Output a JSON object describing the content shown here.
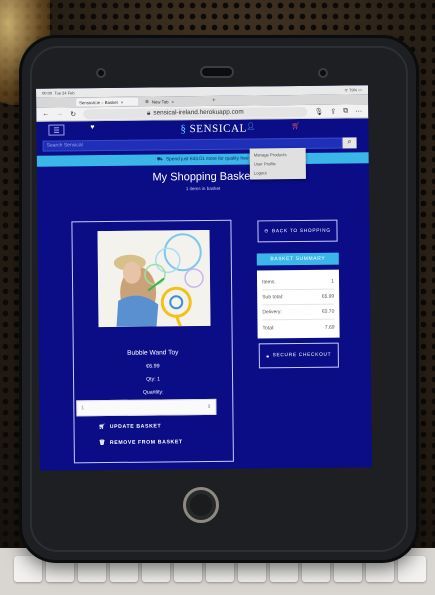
{
  "browser": {
    "status_time": "00:00",
    "status_date": "Tue 24 Feb",
    "status_right": "ᯤ 79% ▭",
    "tabs": [
      {
        "label": "Sensical.ie – Basket",
        "active": true
      },
      {
        "label": "New Tab",
        "active": false
      }
    ],
    "new_tab_label": "+",
    "url": "sensical-ireland.herokuapp.com"
  },
  "site": {
    "logo_text": "SENSICAL",
    "search_placeholder": "Search Sensical",
    "banner_text": "Spend just €43.01 more for quality free",
    "dropdown": [
      "Manage Products",
      "User Profile",
      "Logout"
    ]
  },
  "basket": {
    "title": "My Shopping Basket",
    "subtitle": "1 items in basket"
  },
  "product": {
    "name": "Bubble Wand Toy",
    "price": "€6.99",
    "qty": "Qty: 1",
    "quantity_label": "Quantity:",
    "quantity_value": "1",
    "update_label": "UPDATE BASKET",
    "remove_label": "REMOVE FROM BASKET"
  },
  "sidebar": {
    "back_label": "BACK TO SHOPPING",
    "summary_title": "BASKET SUMMARY",
    "rows": [
      {
        "label": "Items:",
        "value": "1"
      },
      {
        "label": "Sub total:",
        "value": "€6.99"
      },
      {
        "label": "Delivery:",
        "value": "€0.70"
      },
      {
        "label": "Total:",
        "value": "7.69"
      }
    ],
    "checkout_label": "SECURE CHECKOUT"
  },
  "icons": {
    "back": "arrow-left-icon",
    "forward": "arrow-right-icon",
    "reload": "reload-icon",
    "lock": "lock-icon",
    "mic": "microphone-icon",
    "share": "share-icon",
    "tabs": "tabs-icon",
    "more": "more-icon",
    "wishlist": "heart-icon",
    "account": "user-icon",
    "basket": "basket-icon",
    "truck": "truck-icon"
  },
  "colors": {
    "page_background": "#0a0d86",
    "accent": "#3ab7e8",
    "text": "#ffffff"
  }
}
